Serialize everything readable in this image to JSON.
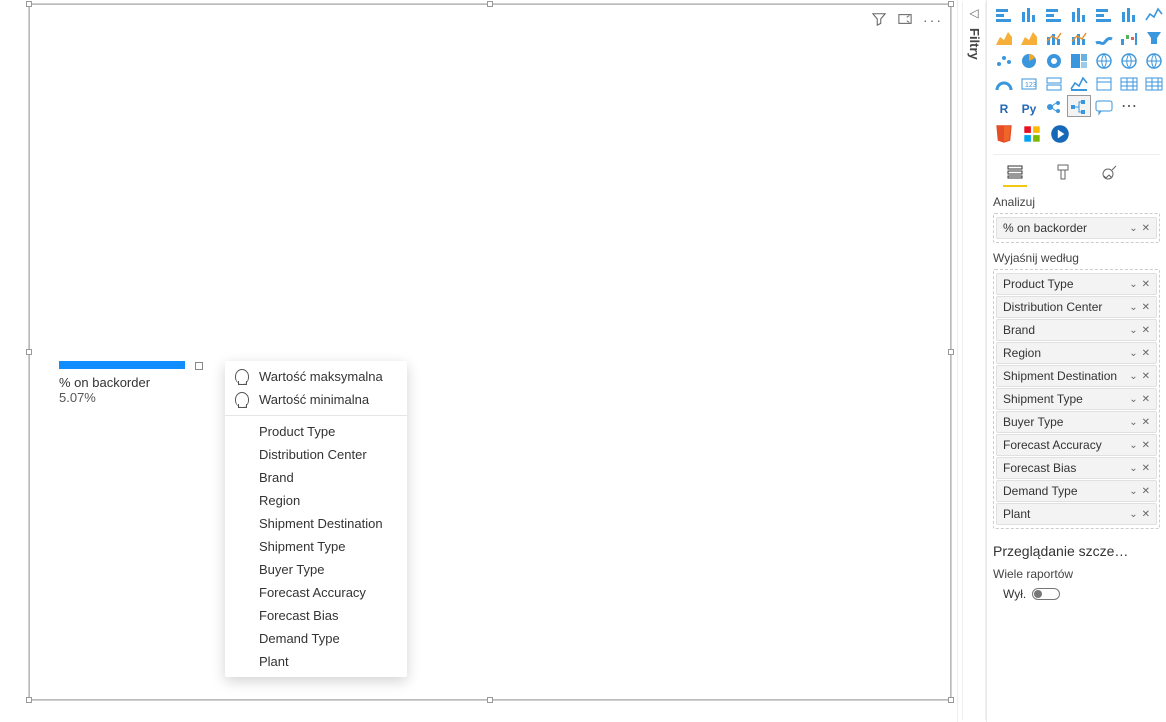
{
  "filters_tab": {
    "label": "Filtry"
  },
  "card": {
    "metric_label": "% on backorder",
    "metric_value": "5.07%"
  },
  "popup": {
    "top": [
      "Wartość maksymalna",
      "Wartość minimalna"
    ],
    "dims": [
      "Product Type",
      "Distribution Center",
      "Brand",
      "Region",
      "Shipment Destination",
      "Shipment Type",
      "Buyer Type",
      "Forecast Accuracy",
      "Forecast Bias",
      "Demand Type",
      "Plant"
    ]
  },
  "panel": {
    "analyze_label": "Analizuj",
    "analyze_field": "% on backorder",
    "explain_label": "Wyjaśnij według",
    "explain_fields": [
      "Product Type",
      "Distribution Center",
      "Brand",
      "Region",
      "Shipment Destination",
      "Shipment Type",
      "Buyer Type",
      "Forecast Accuracy",
      "Forecast Bias",
      "Demand Type",
      "Plant"
    ],
    "drill_title": "Przeglądanie szcze…",
    "drill_sub": "Wiele raportów",
    "toggle_off": "Wył."
  },
  "viz_icons": [
    "stacked-bar",
    "stacked-column",
    "clustered-bar",
    "clustered-column",
    "stacked-bar-100",
    "stacked-column-100",
    "line",
    "area",
    "stacked-area",
    "line-stacked-column",
    "line-clustered-column",
    "ribbon",
    "waterfall",
    "funnel",
    "scatter",
    "pie",
    "donut",
    "treemap",
    "map",
    "filled-map",
    "azure-map",
    "gauge",
    "card",
    "multi-row-card",
    "kpi",
    "slicer",
    "table",
    "matrix",
    "r-visual:R",
    "py-visual:Py",
    "key-influencers",
    "decomposition-tree",
    "qna",
    "more:⋯"
  ]
}
